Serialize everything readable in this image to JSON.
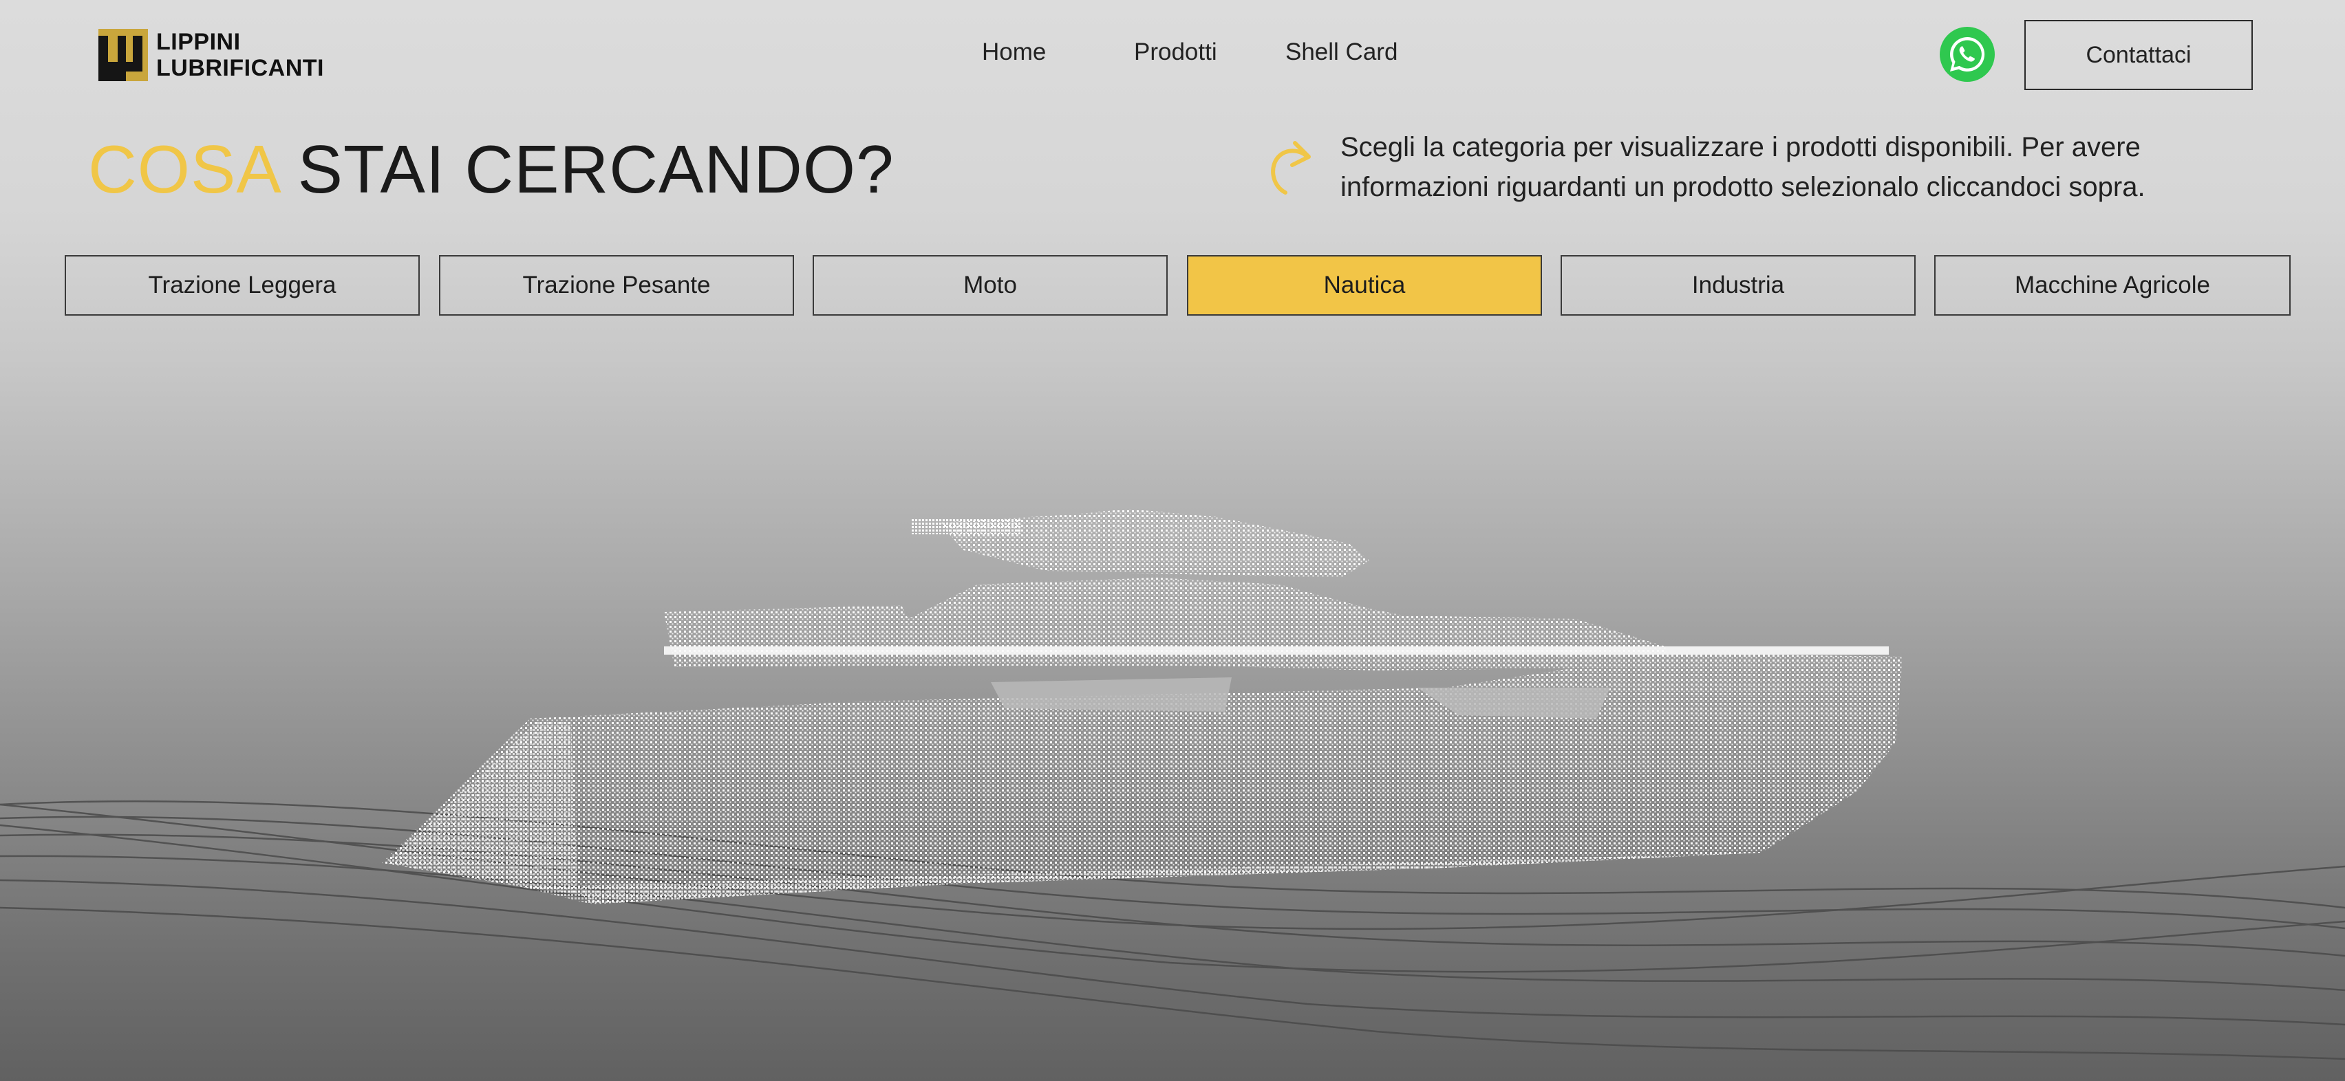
{
  "brand": {
    "logo_line1": "LIPPINI",
    "logo_line2": "LUBRIFICANTI",
    "accent_color": "#f2c547"
  },
  "nav": {
    "items": [
      "Home",
      "Prodotti",
      "Shell Card"
    ],
    "contact_label": "Contattaci",
    "whatsapp_icon": "whatsapp-icon"
  },
  "hero": {
    "title_accent": "COSA",
    "title_rest": "STAI CERCANDO?",
    "intro": "Scegli la categoria per visualizzare i prodotti disponibili. Per avere informazioni riguardanti un prodotto selezionalo cliccandoci sopra.",
    "intro_icon": "curved-arrow-icon"
  },
  "categories": {
    "items": [
      "Trazione Leggera",
      "Trazione Pesante",
      "Moto",
      "Nautica",
      "Industria",
      "Macchine Agricole"
    ],
    "active": "Nautica"
  },
  "scene": {
    "subject": "boat-pointcloud-illustration"
  }
}
